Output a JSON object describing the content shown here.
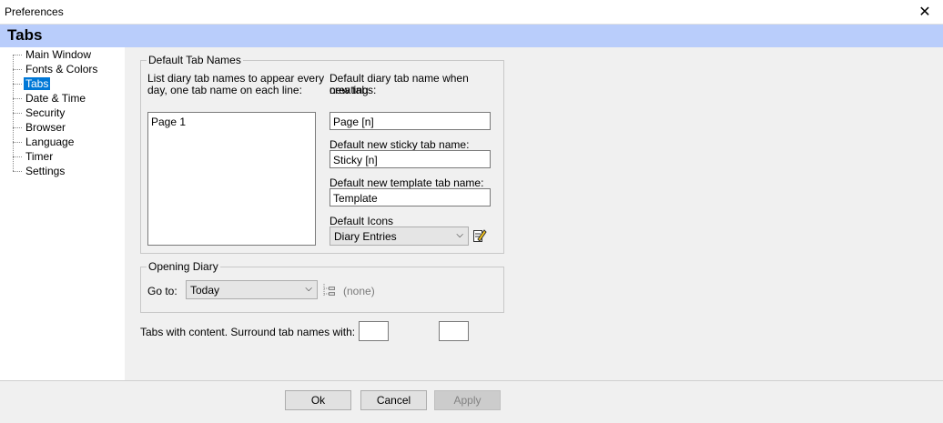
{
  "window": {
    "title": "Preferences",
    "close_icon": "close-icon"
  },
  "header": {
    "title": "Tabs"
  },
  "tree": {
    "items": [
      "Main Window",
      "Fonts & Colors",
      "Tabs",
      "Date & Time",
      "Security",
      "Browser",
      "Language",
      "Timer",
      "Settings"
    ],
    "selected": "Tabs"
  },
  "default_tab_names": {
    "legend": "Default Tab Names",
    "list_label_line1": "List diary tab names to appear every",
    "list_label_line2": "day, one tab name on each line:",
    "list_value": "Page 1",
    "create_label_line1": "Default diary tab name when creating",
    "create_label_line2": "new tabs:",
    "create_value": "Page [n]",
    "sticky_label": "Default new sticky tab name:",
    "sticky_value": "Sticky [n]",
    "template_label": "Default new template tab name:",
    "template_value": "Template",
    "icons_label": "Default Icons",
    "icons_value": "Diary Entries",
    "edit_icon": "edit-pencil-icon"
  },
  "opening_diary": {
    "legend": "Opening Diary",
    "goto_label": "Go to:",
    "goto_value": "Today",
    "tree_icon": "tree-outline-icon",
    "none_text": "(none)"
  },
  "surround": {
    "label": "Tabs with content. Surround tab names with:"
  },
  "buttons": {
    "ok": "Ok",
    "cancel": "Cancel",
    "apply": "Apply"
  },
  "colors": {
    "header_band": "#b9cdfb",
    "selection": "#0078d7"
  }
}
